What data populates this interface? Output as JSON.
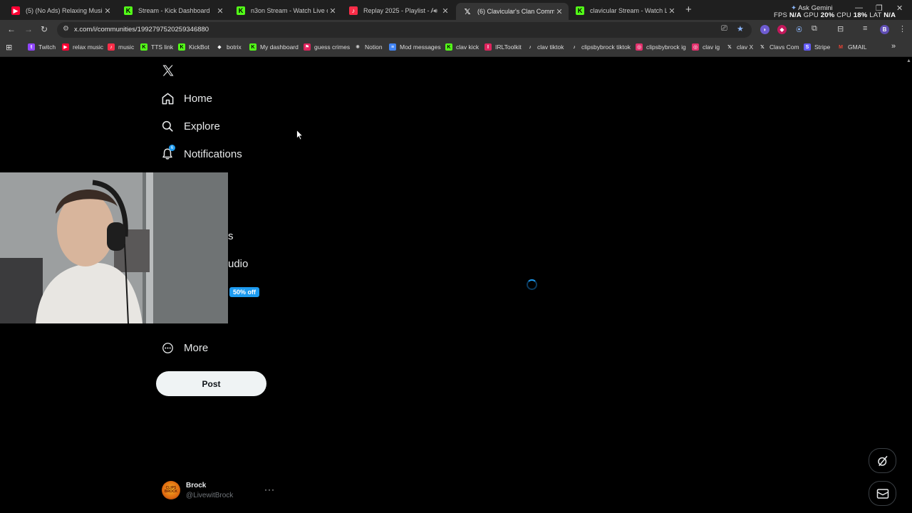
{
  "browser": {
    "tabs": [
      {
        "title": "(5) (No Ads) Relaxing Music Fo",
        "favicon": "youtube-icon",
        "color": "#ff0033"
      },
      {
        "title": "Stream - Kick Dashboard",
        "favicon": "kick-icon",
        "color": "#53fc18"
      },
      {
        "title": "n3on Stream - Watch Live on Ki",
        "favicon": "kick-icon",
        "color": "#53fc18"
      },
      {
        "title": "Replay 2025 - Playlist - App",
        "favicon": "apple-music-icon",
        "color": "#fa2d48"
      },
      {
        "title": "(6) Clavicular's Clan Community",
        "favicon": "x-icon",
        "color": "#ffffff"
      },
      {
        "title": "clavicular Stream - Watch Live o",
        "favicon": "kick-icon",
        "color": "#53fc18"
      }
    ],
    "new_tab_label": "+",
    "gemini_label": "Ask Gemini",
    "stats": {
      "fps_label": "FPS",
      "fps_value": "N/A",
      "gpu_label": "GPU",
      "gpu_value": "20%",
      "cpu_label": "CPU",
      "cpu_value": "18%",
      "lat_label": "LAT",
      "lat_value": "N/A"
    },
    "url": "x.com/i/communities/1992797520259346880",
    "bookmarks": [
      {
        "label": "Twitch",
        "icon": "twitch-icon",
        "color": "#9146ff"
      },
      {
        "label": "relax music",
        "icon": "youtube-icon",
        "color": "#ff0033"
      },
      {
        "label": "music",
        "icon": "apple-music-icon",
        "color": "#fa2d48"
      },
      {
        "label": "TTS link",
        "icon": "kick-icon",
        "color": "#53fc18"
      },
      {
        "label": "KickBot",
        "icon": "kick-icon",
        "color": "#53fc18"
      },
      {
        "label": "botrix",
        "icon": "botrix-icon",
        "color": "#ffffff"
      },
      {
        "label": "My dashboard",
        "icon": "kick-icon",
        "color": "#53fc18"
      },
      {
        "label": "guess crimes",
        "icon": "flag-icon",
        "color": "#e0245e"
      },
      {
        "label": "Notion",
        "icon": "notion-icon",
        "color": "#d0d0d0"
      },
      {
        "label": "Mod messages",
        "icon": "docs-icon",
        "color": "#4285f4"
      },
      {
        "label": "clav kick",
        "icon": "kick-icon",
        "color": "#53fc18"
      },
      {
        "label": "IRLToolkit",
        "icon": "irltoolkit-icon",
        "color": "#e0245e"
      },
      {
        "label": "clav tiktok",
        "icon": "tiktok-icon",
        "color": "#ffffff"
      },
      {
        "label": "clipsbybrock tiktok",
        "icon": "tiktok-icon",
        "color": "#ffffff"
      },
      {
        "label": "clipsbybrock ig",
        "icon": "instagram-icon",
        "color": "#e1306c"
      },
      {
        "label": "clav ig",
        "icon": "instagram-icon",
        "color": "#e1306c"
      },
      {
        "label": "clav X",
        "icon": "x-icon",
        "color": "#ffffff"
      },
      {
        "label": "Clavs Com",
        "icon": "x-icon",
        "color": "#ffffff"
      },
      {
        "label": "Stripe",
        "icon": "stripe-icon",
        "color": "#635bff"
      },
      {
        "label": "GMAIL",
        "icon": "gmail-icon",
        "color": "#ea4335"
      }
    ],
    "bookmarks_overflow": "»",
    "profile_initial": "B"
  },
  "sidebar": {
    "home_label": "Home",
    "explore_label": "Explore",
    "notifications_label": "Notifications",
    "notifications_badge": "6",
    "partial_1": "s",
    "partial_2": "udio",
    "promo_badge": "50% off",
    "more_label": "More",
    "post_label": "Post"
  },
  "account": {
    "name": "Brock",
    "handle": "@LivewitBrock",
    "more": "···",
    "avatar_text": "CLIPS BROCK"
  },
  "colors": {
    "accent": "#1d9bf0",
    "background": "#000000",
    "text": "#e7e9ea",
    "muted": "#71767b"
  }
}
